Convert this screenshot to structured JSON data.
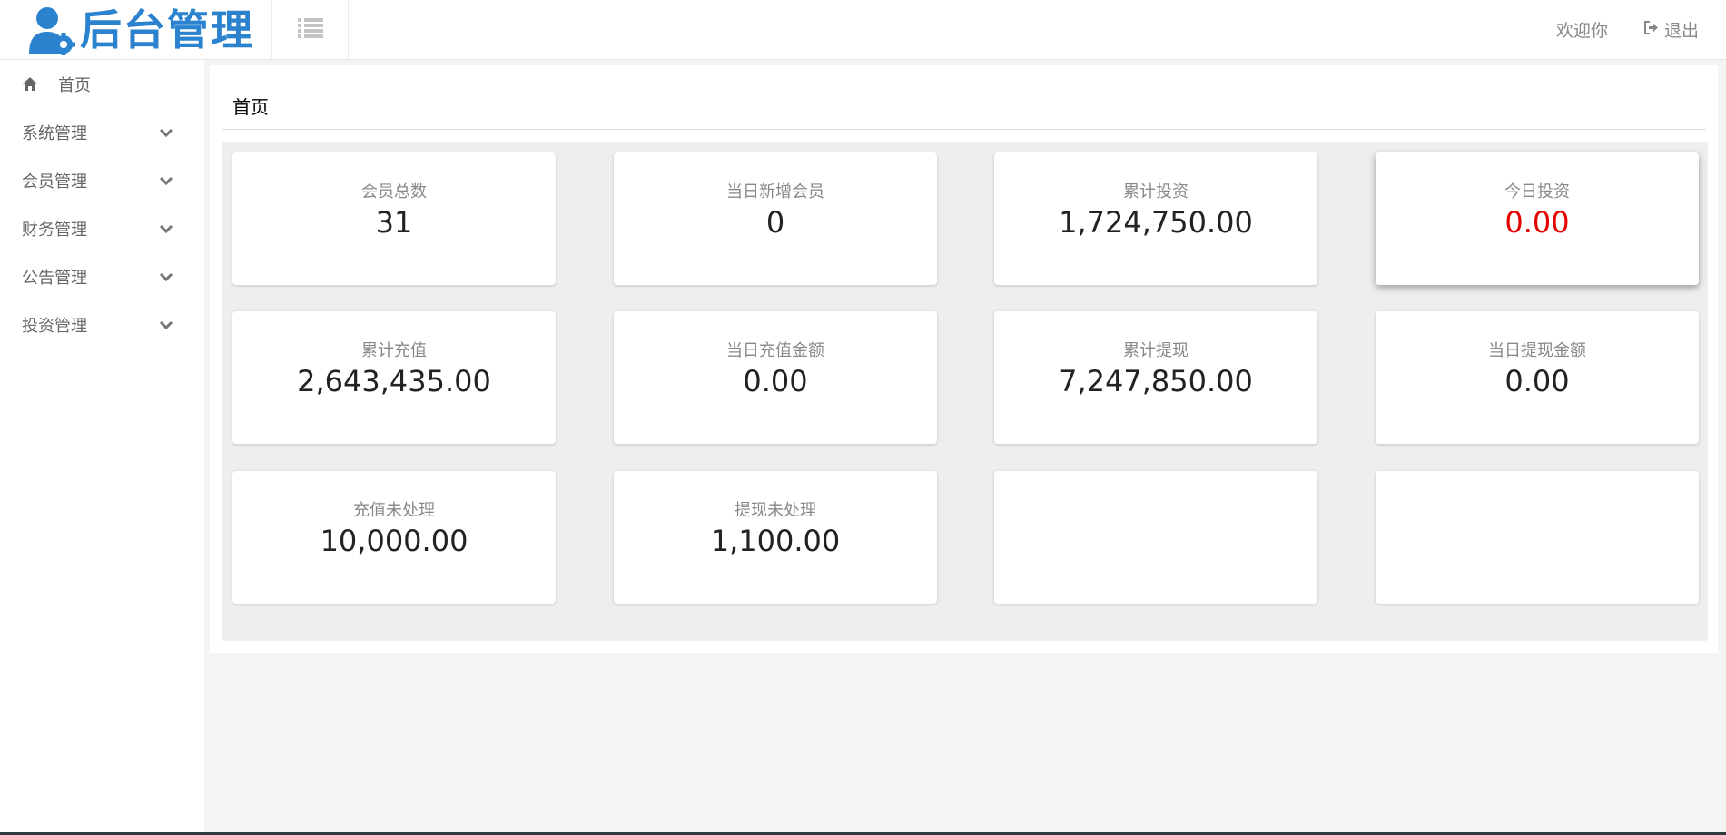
{
  "header": {
    "logo_text": "后台管理",
    "welcome": "欢迎你",
    "logout": "退出"
  },
  "sidebar": {
    "items": [
      {
        "label": "首页",
        "icon": "home-icon"
      },
      {
        "label": "系统管理",
        "icon": "chevron-down-icon"
      },
      {
        "label": "会员管理",
        "icon": "chevron-down-icon"
      },
      {
        "label": "财务管理",
        "icon": "chevron-down-icon"
      },
      {
        "label": "公告管理",
        "icon": "chevron-down-icon"
      },
      {
        "label": "投资管理",
        "icon": "chevron-down-icon"
      }
    ]
  },
  "main": {
    "title": "首页",
    "stats": [
      {
        "label": "会员总数",
        "value": "31"
      },
      {
        "label": "当日新增会员",
        "value": "0"
      },
      {
        "label": "累计投资",
        "value": "1,724,750.00"
      },
      {
        "label": "今日投资",
        "value": "0.00",
        "value_color": "#e60000"
      },
      {
        "label": "累计充值",
        "value": "2,643,435.00"
      },
      {
        "label": "当日充值金额",
        "value": "0.00"
      },
      {
        "label": "累计提现",
        "value": "7,247,850.00"
      },
      {
        "label": "当日提现金额",
        "value": "0.00"
      },
      {
        "label": "充值未处理",
        "value": "10,000.00"
      },
      {
        "label": "提现未处理",
        "value": "1,100.00"
      },
      {
        "label": "",
        "value": ""
      },
      {
        "label": "",
        "value": ""
      }
    ]
  },
  "colors": {
    "brand": "#2b83cf",
    "alert": "#e60000"
  }
}
